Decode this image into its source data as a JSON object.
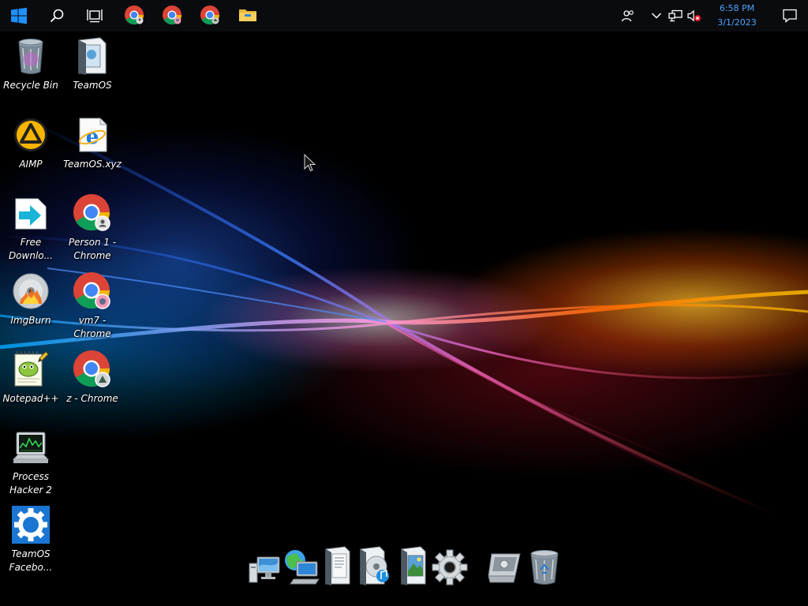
{
  "taskbar": {
    "start_icon": "windows-logo-icon",
    "search_icon": "search-icon",
    "task_view_icon": "task-view-icon",
    "pinned_apps": [
      {
        "name": "chrome-person-1",
        "icon": "chrome-icon"
      },
      {
        "name": "chrome-vm7",
        "icon": "chrome-icon"
      },
      {
        "name": "chrome-z",
        "icon": "chrome-icon"
      },
      {
        "name": "file-explorer",
        "icon": "folder-icon"
      }
    ],
    "tray": {
      "icons": [
        "people-icon",
        "chevron-up-icon",
        "network-icon",
        "volume-muted-icon"
      ],
      "time": "6:58 PM",
      "date": "3/1/2023",
      "notification_icon": "action-center-icon"
    }
  },
  "desktop": {
    "icons": [
      {
        "label": "Recycle Bin",
        "icon": "recycle-bin-icon"
      },
      {
        "label": "TeamOS",
        "icon": "folder-document-icon"
      },
      {
        "label": "AIMP",
        "icon": "aimp-icon"
      },
      {
        "label": "TeamOS.xyz",
        "icon": "internet-explorer-icon"
      },
      {
        "label": "Free Downlo...",
        "icon": "free-download-manager-icon"
      },
      {
        "label": "Person 1 - Chrome",
        "icon": "chrome-icon"
      },
      {
        "label": "ImgBurn",
        "icon": "imgburn-icon"
      },
      {
        "label": "vm7 - Chrome",
        "icon": "chrome-icon"
      },
      {
        "label": "Notepad++",
        "icon": "notepad-plus-plus-icon"
      },
      {
        "label": "z - Chrome",
        "icon": "chrome-icon"
      },
      {
        "label": "Process Hacker 2",
        "icon": "process-hacker-icon"
      },
      {
        "label": "TeamOS Facebo...",
        "icon": "gear-icon"
      }
    ]
  },
  "dock": {
    "items": [
      {
        "name": "computer",
        "icon": "computer-icon"
      },
      {
        "name": "network",
        "icon": "network-globe-icon"
      },
      {
        "name": "documents",
        "icon": "documents-folder-icon"
      },
      {
        "name": "music",
        "icon": "music-folder-icon"
      },
      {
        "name": "pictures",
        "icon": "pictures-folder-icon"
      },
      {
        "name": "settings",
        "icon": "gear-icon"
      },
      {
        "name": "control-panel",
        "icon": "control-panel-icon"
      },
      {
        "name": "recycle-bin",
        "icon": "recycle-bin-icon"
      }
    ]
  },
  "colors": {
    "taskbar_bg": "#0a0b0e",
    "clock_text": "#4da3ff",
    "windows_blue": "#1e90ff"
  }
}
